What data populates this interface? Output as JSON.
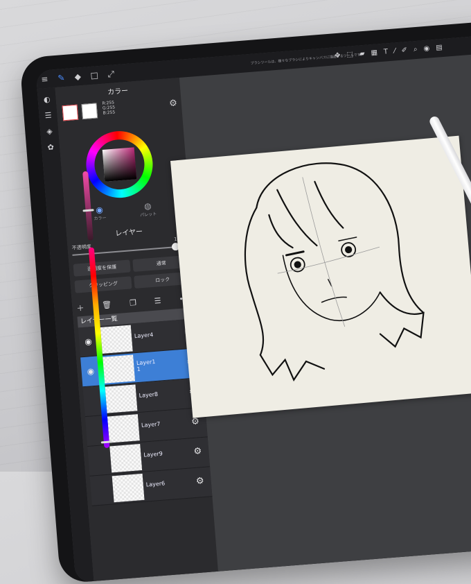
{
  "topbar": {
    "message": "ブラシツールは、様々なブラシによりキャンバスに描画するツールです。",
    "left_icons": [
      "menu-icon",
      "brush-icon",
      "eraser-icon",
      "square-icon",
      "transform-icon"
    ],
    "right_icons": [
      "move-icon",
      "select-icon",
      "fill-icon",
      "gradient-icon",
      "text-icon",
      "eyedropper-icon",
      "pen-icon",
      "smudge-icon",
      "search-icon",
      "view-icon",
      "reference-icon",
      "ruler-icon"
    ]
  },
  "color": {
    "title": "カラー",
    "r": "R:255",
    "g": "G:255",
    "b": "B:255",
    "tab_color": "カラー",
    "tab_palette": "パレット",
    "fg_color": "#ffffff",
    "accent": "#3d7fd6"
  },
  "layer_panel": {
    "title": "レイヤー",
    "opacity_label": "不透明度",
    "opacity_value": "100%",
    "protect_alpha": "透明度を保護",
    "blend_mode": "通常",
    "clipping": "クリッピング",
    "lock": "ロック",
    "group_header": "レイヤー一覧",
    "layers": [
      {
        "name": "Layer4",
        "visible": true,
        "selected": false
      },
      {
        "name": "Layer1\n1",
        "visible": true,
        "selected": true
      },
      {
        "name": "Layer8",
        "visible": false,
        "selected": false
      },
      {
        "name": "Layer7",
        "visible": false,
        "selected": false
      },
      {
        "name": "Layer9",
        "visible": false,
        "selected": false
      },
      {
        "name": "Layer6",
        "visible": false,
        "selected": false
      }
    ]
  }
}
